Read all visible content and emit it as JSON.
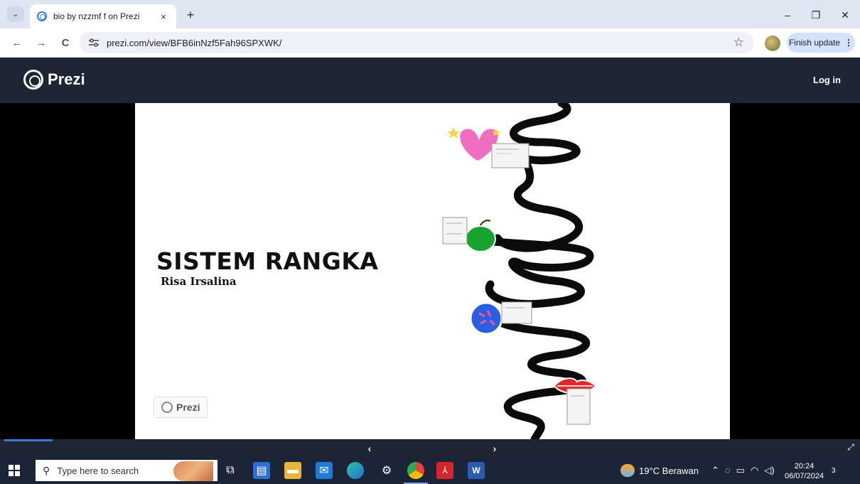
{
  "browser": {
    "tab_title": "bio by nzzmf f on Prezi",
    "tab_close": "×",
    "new_tab": "+",
    "url": "prezi.com/view/BFB6inNzf5Fah96SPXWK/",
    "finish_update": "Finish update",
    "finish_update_menu": "⋮",
    "tab_menu": "⌄",
    "back": "←",
    "forward": "→",
    "reload": "C",
    "star": "☆",
    "minimize": "–",
    "restore": "❐",
    "close": "✕"
  },
  "prezi": {
    "brand": "Prezi",
    "login": "Log in"
  },
  "slide": {
    "title": "SISTEM RANGKA",
    "subtitle": "Risa Irsalina",
    "badge": "Prezi"
  },
  "controls": {
    "prev": "‹",
    "next": "›",
    "fullscreen": "⤢",
    "progress": 0.06
  },
  "taskbar": {
    "search_placeholder": "Type here to search",
    "weather": "19°C  Berawan",
    "time": "20:24",
    "date": "06/07/2024",
    "notifications": "3"
  },
  "colors": {
    "prezi_header": "#1e2534",
    "taskbar": "#1c2538",
    "accent": "#3a7bd5"
  }
}
